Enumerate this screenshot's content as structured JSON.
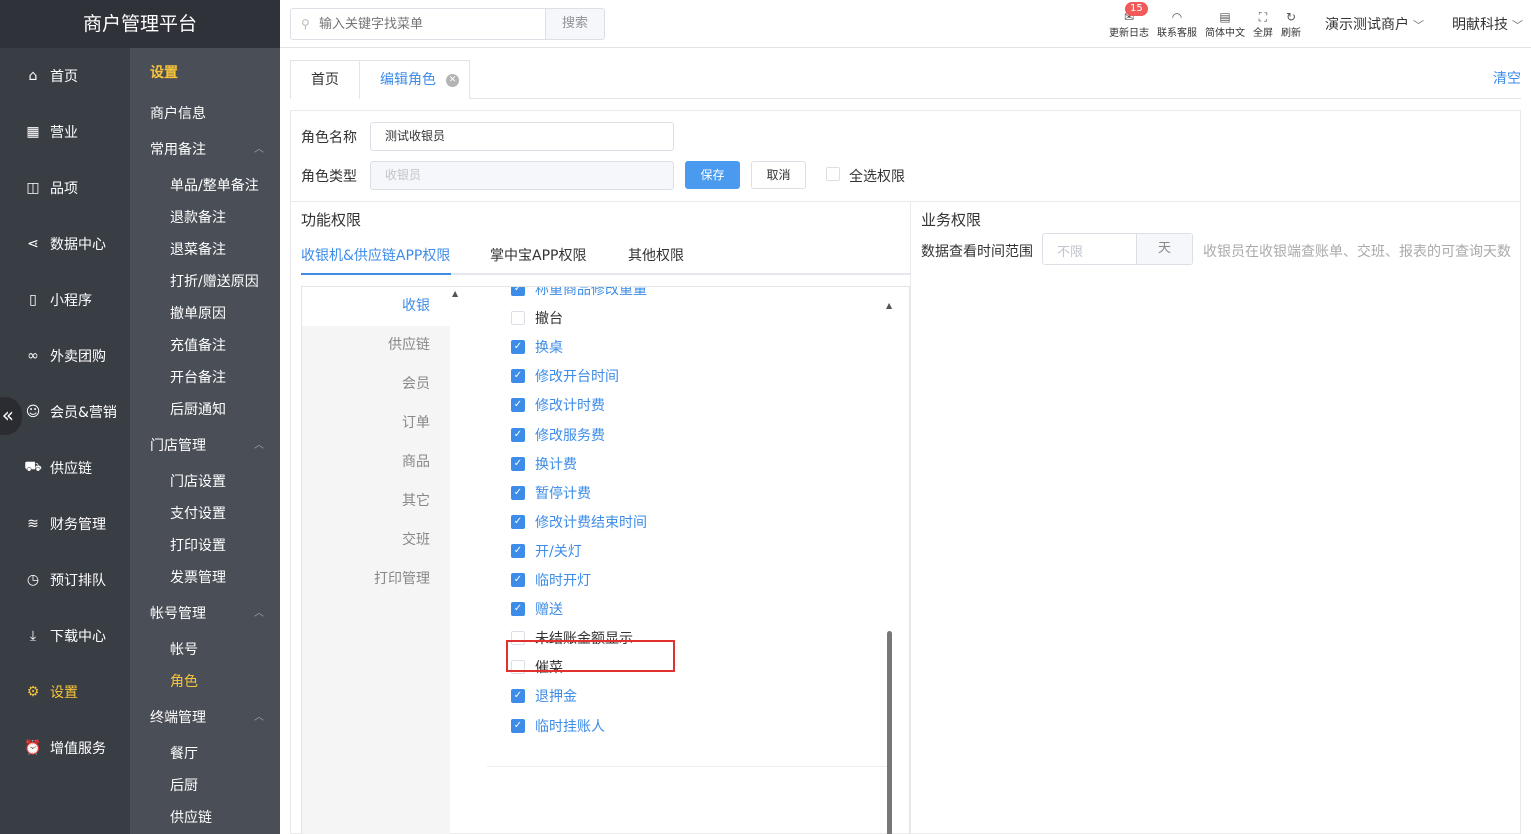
{
  "brand": {
    "title": "商户管理平台"
  },
  "nav_primary": [
    {
      "label": "首页",
      "icon": "home-icon"
    },
    {
      "label": "营业",
      "icon": "calendar-icon"
    },
    {
      "label": "品项",
      "icon": "bag-icon"
    },
    {
      "label": "数据中心",
      "icon": "share-icon"
    },
    {
      "label": "小程序",
      "icon": "phone-icon"
    },
    {
      "label": "外卖团购",
      "icon": "bike-icon"
    },
    {
      "label": "会员&营销",
      "icon": "user-icon"
    },
    {
      "label": "供应链",
      "icon": "truck-icon"
    },
    {
      "label": "财务管理",
      "icon": "database-icon"
    },
    {
      "label": "预订排队",
      "icon": "clock-icon"
    },
    {
      "label": "下载中心",
      "icon": "download-icon"
    },
    {
      "label": "设置",
      "icon": "gear-icon",
      "active": true
    },
    {
      "label": "增值服务",
      "icon": "alarm-icon"
    }
  ],
  "collapse_glyph": "«",
  "nav_secondary": {
    "header": "设置",
    "items": [
      {
        "label": "商户信息",
        "level": 1
      },
      {
        "label": "常用备注",
        "level": 1,
        "group": true
      },
      {
        "label": "单品/整单备注",
        "level": 2
      },
      {
        "label": "退款备注",
        "level": 2
      },
      {
        "label": "退菜备注",
        "level": 2
      },
      {
        "label": "打折/赠送原因",
        "level": 2
      },
      {
        "label": "撤单原因",
        "level": 2
      },
      {
        "label": "充值备注",
        "level": 2
      },
      {
        "label": "开台备注",
        "level": 2
      },
      {
        "label": "后厨通知",
        "level": 2
      },
      {
        "label": "门店管理",
        "level": 1,
        "group": true
      },
      {
        "label": "门店设置",
        "level": 2
      },
      {
        "label": "支付设置",
        "level": 2
      },
      {
        "label": "打印设置",
        "level": 2
      },
      {
        "label": "发票管理",
        "level": 2
      },
      {
        "label": "帐号管理",
        "level": 1,
        "group": true
      },
      {
        "label": "帐号",
        "level": 2
      },
      {
        "label": "角色",
        "level": 2,
        "active": true
      },
      {
        "label": "终端管理",
        "level": 1,
        "group": true
      },
      {
        "label": "餐厅",
        "level": 2
      },
      {
        "label": "后厨",
        "level": 2
      },
      {
        "label": "供应链",
        "level": 2
      }
    ]
  },
  "topbar": {
    "search_placeholder": "输入关键字找菜单",
    "search_button": "搜索",
    "tools": [
      {
        "label": "更新日志",
        "icon": "notice-icon",
        "badge": "15"
      },
      {
        "label": "联系客服",
        "icon": "headset-icon"
      },
      {
        "label": "简体中文",
        "icon": "language-icon"
      },
      {
        "label": "全屏",
        "icon": "fullscreen-icon"
      },
      {
        "label": "刷新",
        "icon": "refresh-icon"
      }
    ],
    "merchant": "演示测试商户",
    "company": "明献科技"
  },
  "tabs": {
    "home": "首页",
    "edit": "编辑角色",
    "clear": "清空"
  },
  "form": {
    "name_label": "角色名称",
    "name_value": "测试收银员",
    "type_label": "角色类型",
    "type_value": "收银员",
    "save": "保存",
    "cancel": "取消",
    "select_all": "全选权限"
  },
  "function_perm": {
    "title": "功能权限",
    "tabs": [
      "收银机&供应链APP权限",
      "掌中宝APP权限",
      "其他权限"
    ],
    "categories": [
      "收银",
      "供应链",
      "会员",
      "订单",
      "商品",
      "其它",
      "交班",
      "打印管理"
    ],
    "items": [
      {
        "label": "称重商品修改重量",
        "checked": true
      },
      {
        "label": "撤台",
        "checked": false
      },
      {
        "label": "换桌",
        "checked": true
      },
      {
        "label": "修改开台时间",
        "checked": true
      },
      {
        "label": "修改计时费",
        "checked": true
      },
      {
        "label": "修改服务费",
        "checked": true
      },
      {
        "label": "换计费",
        "checked": true
      },
      {
        "label": "暂停计费",
        "checked": true
      },
      {
        "label": "修改计费结束时间",
        "checked": true
      },
      {
        "label": "开/关灯",
        "checked": true
      },
      {
        "label": "临时开灯",
        "checked": true
      },
      {
        "label": "赠送",
        "checked": true
      },
      {
        "label": "未结账金额显示",
        "checked": false
      },
      {
        "label": "催菜",
        "checked": false
      },
      {
        "label": "退押金",
        "checked": true
      },
      {
        "label": "临时挂账人",
        "checked": true
      }
    ]
  },
  "business_perm": {
    "title": "业务权限",
    "range_label": "数据查看时间范围",
    "range_placeholder": "不限",
    "range_unit": "天",
    "range_hint": "收银员在收银端查账单、交班、报表的可查询天数"
  },
  "colors": {
    "accent": "#3d8ce8",
    "active_nav": "#f7c43a",
    "highlight": "#e0312f"
  }
}
